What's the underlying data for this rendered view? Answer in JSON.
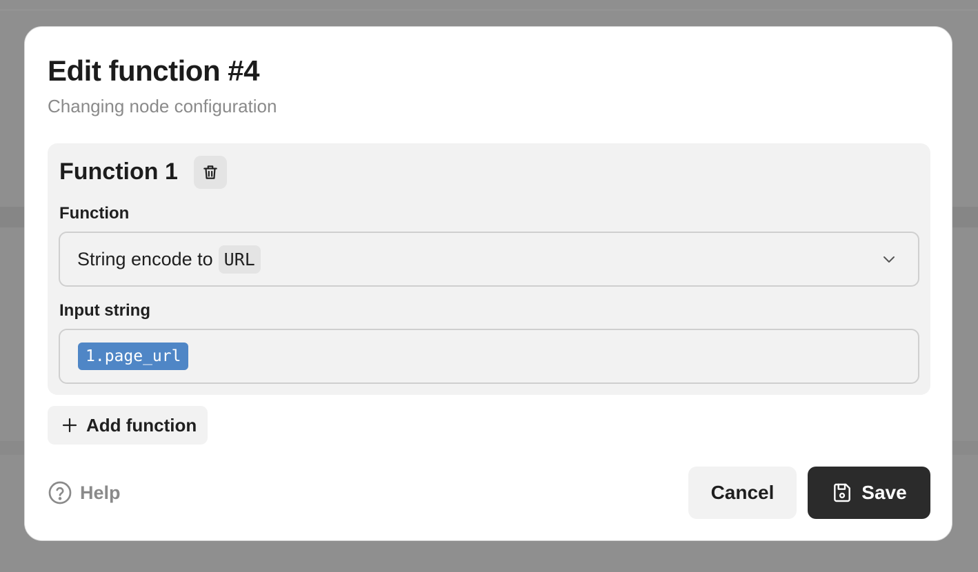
{
  "dialog": {
    "title": "Edit function #4",
    "subtitle": "Changing node configuration"
  },
  "function_card": {
    "title": "Function 1",
    "delete_icon": "trash-icon",
    "function_label": "Function",
    "function_select": {
      "text": "String encode to",
      "code": "URL",
      "icon": "chevron-down-icon"
    },
    "input_label": "Input string",
    "input_value": "1.page_url"
  },
  "add_function": {
    "icon": "plus-icon",
    "label": "Add function"
  },
  "footer": {
    "help_icon": "question-circle-icon",
    "help_label": "Help",
    "cancel_label": "Cancel",
    "save_icon": "floppy-disk-icon",
    "save_label": "Save"
  },
  "colors": {
    "chip_blue": "#4f86c6",
    "save_bg": "#2b2b2b",
    "card_bg": "#f2f2f2"
  }
}
